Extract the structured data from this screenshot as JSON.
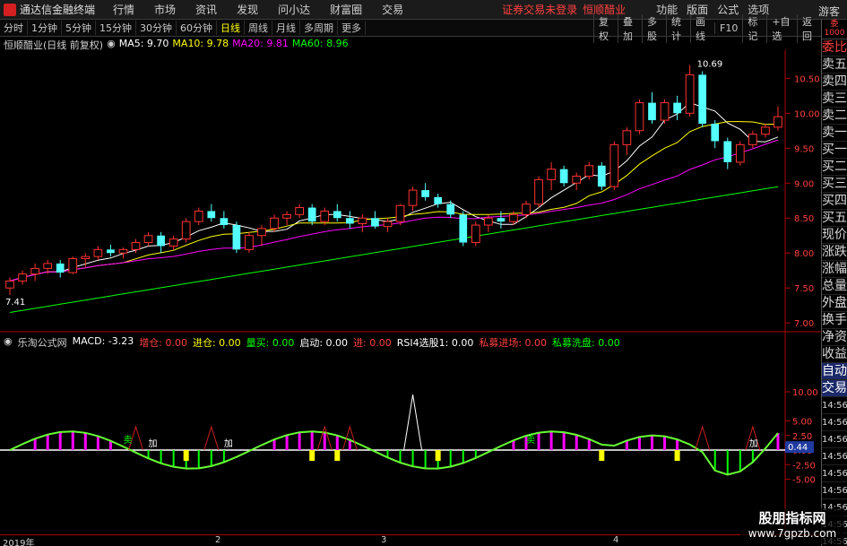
{
  "app": {
    "title": "通达信金融终端",
    "menu": [
      "行情",
      "市场",
      "资讯",
      "发现",
      "问小达",
      "财富圈",
      "交易"
    ],
    "login_status": "证券交易未登录",
    "stock_name": "恒顺醋业",
    "right_menu": [
      "功能",
      "版面",
      "公式",
      "选项"
    ],
    "guest": "游客"
  },
  "toolbar": {
    "periods": [
      "分时",
      "1分钟",
      "5分钟",
      "15分钟",
      "30分钟",
      "60分钟",
      "日线",
      "周线",
      "月线",
      "多周期",
      "更多"
    ],
    "active_period": "日线",
    "right_items": [
      "复权",
      "叠加",
      "多股",
      "统计",
      "画线",
      "F10",
      "标记",
      "+自选",
      "返回"
    ]
  },
  "info_line": {
    "stock_label": "恒顺醋业(日线 前复权)",
    "ma5": "MA5: 9.70",
    "ma10": "MA10: 9.78",
    "ma20": "MA20: 9.81",
    "ma60": "MA60: 8.96"
  },
  "price_axis": {
    "ticks": [
      "10.50",
      "10.00",
      "9.50",
      "9.00",
      "8.50",
      "8.00",
      "7.50",
      "7.00"
    ],
    "high_label": "10.69",
    "low_label": "7.41"
  },
  "indicator": {
    "name": "乐淘公式网",
    "macd": "MACD: -3.23",
    "zengcang": "增仓: 0.00",
    "jincang": "进仓: 0.00",
    "liangmai": "量买: 0.00",
    "qidong": "启动: 0.00",
    "jin": "进: 0.00",
    "rsi": "RSI4选股1: 0.00",
    "simu_jin": "私募进场: 0.00",
    "simu_xi": "私募洗盘: 0.00",
    "axis_ticks": [
      "10.00",
      "5.00",
      "2.50",
      "0.00",
      "-2.50",
      "-5.00"
    ],
    "current_value": "0.44",
    "marker_mai": "卖",
    "marker_jia": "加"
  },
  "side_panel": {
    "top_lines": [
      "委",
      "比",
      "1000"
    ],
    "items": [
      "委比",
      "卖五",
      "卖四",
      "卖三",
      "卖二",
      "卖一",
      "买一",
      "买二",
      "买三",
      "买四",
      "买五",
      "现价",
      "涨跌",
      "涨幅",
      "总量",
      "外盘",
      "换手",
      "净资",
      "收益"
    ],
    "auto_trade": [
      "自动",
      "交易"
    ],
    "times": [
      "14:56",
      "14:56",
      "14:56",
      "14:56",
      "14:56",
      "14:56",
      "14:56",
      "14:56",
      "14:56"
    ]
  },
  "date_axis": {
    "labels": [
      "2019年",
      "2",
      "3",
      "4"
    ]
  },
  "watermark": {
    "line1": "股朋指标网",
    "line2": "www.7gpzb.com"
  },
  "colors": {
    "up": "#ff3232",
    "down": "#54ffff",
    "ma5": "#ffffff",
    "ma10": "#ffff00",
    "ma20": "#ff00ff",
    "ma60": "#00ff00"
  },
  "chart_data": {
    "type": "candlestick",
    "price_range": [
      6.9,
      10.85
    ],
    "candles": [
      [
        7.5,
        7.65,
        7.4,
        7.6
      ],
      [
        7.6,
        7.75,
        7.55,
        7.7
      ],
      [
        7.7,
        7.85,
        7.6,
        7.78
      ],
      [
        7.78,
        7.9,
        7.7,
        7.85
      ],
      [
        7.85,
        7.9,
        7.65,
        7.72
      ],
      [
        7.72,
        7.95,
        7.7,
        7.92
      ],
      [
        7.92,
        8.0,
        7.8,
        7.95
      ],
      [
        7.95,
        8.1,
        7.9,
        8.05
      ],
      [
        8.05,
        8.12,
        7.95,
        8.0
      ],
      [
        8.0,
        8.08,
        7.92,
        8.05
      ],
      [
        8.05,
        8.2,
        8.0,
        8.15
      ],
      [
        8.15,
        8.3,
        8.1,
        8.25
      ],
      [
        8.25,
        8.3,
        8.0,
        8.1
      ],
      [
        8.1,
        8.25,
        8.05,
        8.2
      ],
      [
        8.2,
        8.5,
        8.15,
        8.45
      ],
      [
        8.45,
        8.65,
        8.4,
        8.6
      ],
      [
        8.6,
        8.7,
        8.45,
        8.5
      ],
      [
        8.5,
        8.6,
        8.35,
        8.4
      ],
      [
        8.4,
        8.45,
        8.0,
        8.05
      ],
      [
        8.05,
        8.3,
        8.0,
        8.25
      ],
      [
        8.25,
        8.4,
        8.1,
        8.35
      ],
      [
        8.35,
        8.55,
        8.3,
        8.5
      ],
      [
        8.5,
        8.6,
        8.4,
        8.55
      ],
      [
        8.55,
        8.7,
        8.5,
        8.65
      ],
      [
        8.65,
        8.7,
        8.4,
        8.45
      ],
      [
        8.45,
        8.65,
        8.4,
        8.6
      ],
      [
        8.6,
        8.7,
        8.45,
        8.5
      ],
      [
        8.5,
        8.6,
        8.35,
        8.42
      ],
      [
        8.42,
        8.55,
        8.3,
        8.5
      ],
      [
        8.5,
        8.6,
        8.35,
        8.38
      ],
      [
        8.38,
        8.5,
        8.3,
        8.45
      ],
      [
        8.45,
        8.7,
        8.4,
        8.68
      ],
      [
        8.68,
        8.95,
        8.6,
        8.9
      ],
      [
        8.9,
        9.0,
        8.75,
        8.8
      ],
      [
        8.8,
        8.85,
        8.65,
        8.7
      ],
      [
        8.7,
        8.75,
        8.5,
        8.55
      ],
      [
        8.55,
        8.6,
        8.1,
        8.15
      ],
      [
        8.15,
        8.45,
        8.1,
        8.4
      ],
      [
        8.4,
        8.55,
        8.3,
        8.5
      ],
      [
        8.5,
        8.6,
        8.35,
        8.45
      ],
      [
        8.45,
        8.6,
        8.4,
        8.55
      ],
      [
        8.55,
        8.75,
        8.5,
        8.7
      ],
      [
        8.7,
        9.1,
        8.65,
        9.05
      ],
      [
        9.05,
        9.3,
        8.9,
        9.2
      ],
      [
        9.2,
        9.25,
        8.95,
        9.0
      ],
      [
        9.0,
        9.15,
        8.9,
        9.1
      ],
      [
        9.1,
        9.3,
        9.05,
        9.25
      ],
      [
        9.25,
        9.3,
        8.9,
        8.95
      ],
      [
        8.95,
        9.6,
        8.9,
        9.55
      ],
      [
        9.55,
        9.8,
        9.4,
        9.75
      ],
      [
        9.75,
        10.2,
        9.7,
        10.15
      ],
      [
        10.15,
        10.3,
        9.85,
        9.9
      ],
      [
        9.9,
        10.2,
        9.85,
        10.15
      ],
      [
        10.15,
        10.25,
        9.9,
        10.0
      ],
      [
        10.0,
        10.69,
        9.95,
        10.55
      ],
      [
        10.55,
        10.6,
        9.8,
        9.85
      ],
      [
        9.85,
        9.9,
        9.5,
        9.6
      ],
      [
        9.6,
        9.65,
        9.2,
        9.3
      ],
      [
        9.3,
        9.6,
        9.25,
        9.55
      ],
      [
        9.55,
        9.75,
        9.5,
        9.7
      ],
      [
        9.7,
        9.85,
        9.65,
        9.8
      ],
      [
        9.8,
        10.1,
        9.75,
        9.95
      ]
    ]
  }
}
